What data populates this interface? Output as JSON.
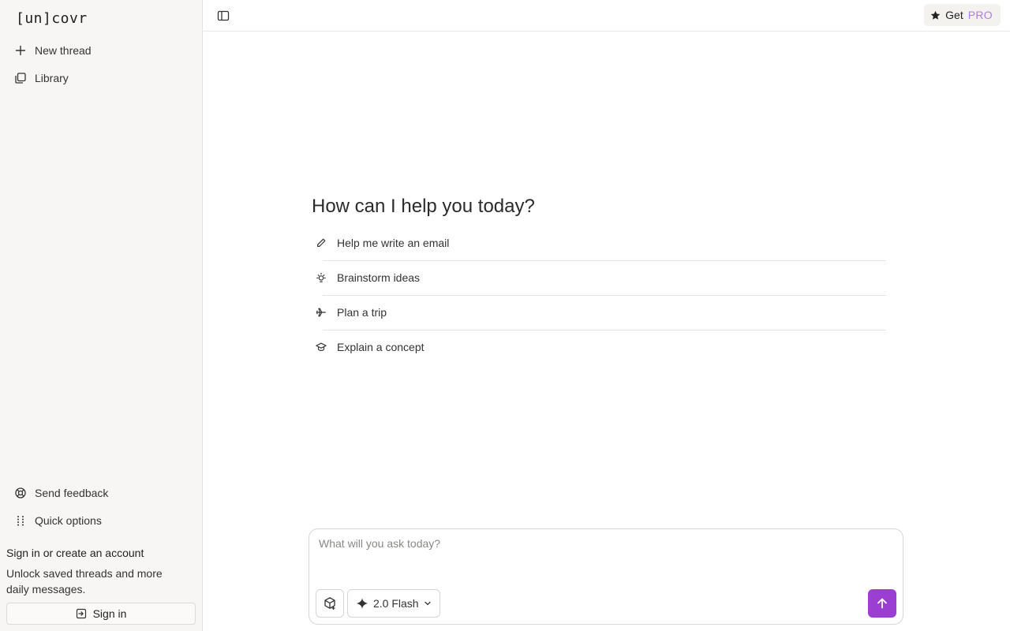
{
  "brand": {
    "logo_text": "[un]covr"
  },
  "sidebar": {
    "items": [
      {
        "label": "New thread",
        "icon": "plus-icon"
      },
      {
        "label": "Library",
        "icon": "library-icon"
      }
    ],
    "footer_items": [
      {
        "label": "Send feedback",
        "icon": "lifebuoy-icon"
      },
      {
        "label": "Quick options",
        "icon": "grid-dots-icon"
      }
    ],
    "signin": {
      "title": "Sign in or create an account",
      "subtitle": "Unlock saved threads and more daily messages.",
      "button_label": "Sign in"
    }
  },
  "topbar": {
    "toggle_icon": "sidebar-toggle-icon",
    "pro_button": {
      "prefix": "Get",
      "highlight": "PRO",
      "icon": "star-icon"
    }
  },
  "main": {
    "heading": "How can I help you today?",
    "suggestions": [
      {
        "label": "Help me write an email",
        "icon": "pencil-icon"
      },
      {
        "label": "Brainstorm ideas",
        "icon": "lightbulb-icon"
      },
      {
        "label": "Plan a trip",
        "icon": "plane-icon"
      },
      {
        "label": "Explain a concept",
        "icon": "graduation-cap-icon"
      }
    ]
  },
  "composer": {
    "placeholder": "What will you ask today?",
    "value": "",
    "model_label": "2.0 Flash",
    "model_icon": "sparkle-icon",
    "tool_icon": "box-plus-icon",
    "send_icon": "arrow-up-icon"
  },
  "colors": {
    "accent": "#9a3fd2",
    "pro_text": "#b07ee0",
    "sidebar_bg": "#f7f6f4"
  }
}
